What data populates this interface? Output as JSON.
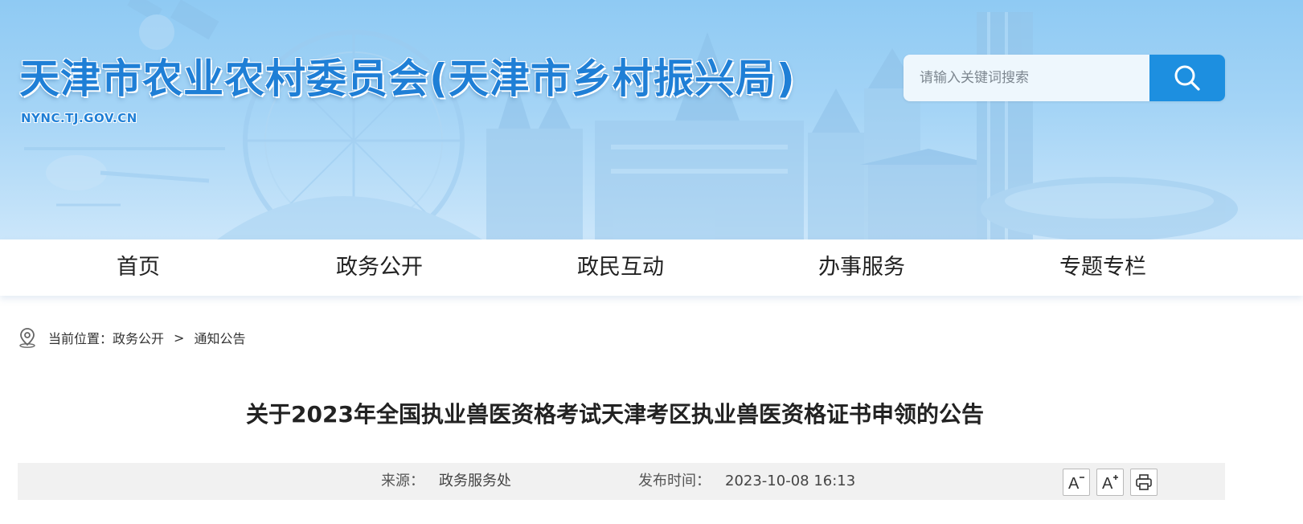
{
  "header": {
    "site_title": "天津市农业农村委员会(天津市乡村振兴局)",
    "site_domain": "NYNC.TJ.GOV.CN",
    "search": {
      "placeholder": "请输入关键词搜索",
      "value": "",
      "button_icon": "search-icon"
    }
  },
  "nav": {
    "items": [
      {
        "label": "首页"
      },
      {
        "label": "政务公开"
      },
      {
        "label": "政民互动"
      },
      {
        "label": "办事服务"
      },
      {
        "label": "专题专栏"
      }
    ]
  },
  "breadcrumb": {
    "icon": "location-pin-icon",
    "prefix": "当前位置：",
    "items": [
      {
        "label": "政务公开"
      },
      {
        "label": "通知公告"
      }
    ],
    "separator": ">"
  },
  "article": {
    "title": "关于2023年全国执业兽医资格考试天津考区执业兽医资格证书申领的公告",
    "meta": {
      "source_label": "来源：",
      "source_value": "政务服务处",
      "date_label": "发布时间：",
      "date_value": "2023-10-08 16:13"
    },
    "tools": {
      "font_decrease_icon": "font-decrease-icon",
      "font_increase_icon": "font-increase-icon",
      "print_icon": "print-icon"
    }
  },
  "colors": {
    "brand_blue": "#1f7fd6",
    "search_button": "#1d8fe0",
    "banner_sky": "#a4d4f6",
    "meta_bar_bg": "#f1f1f1"
  }
}
